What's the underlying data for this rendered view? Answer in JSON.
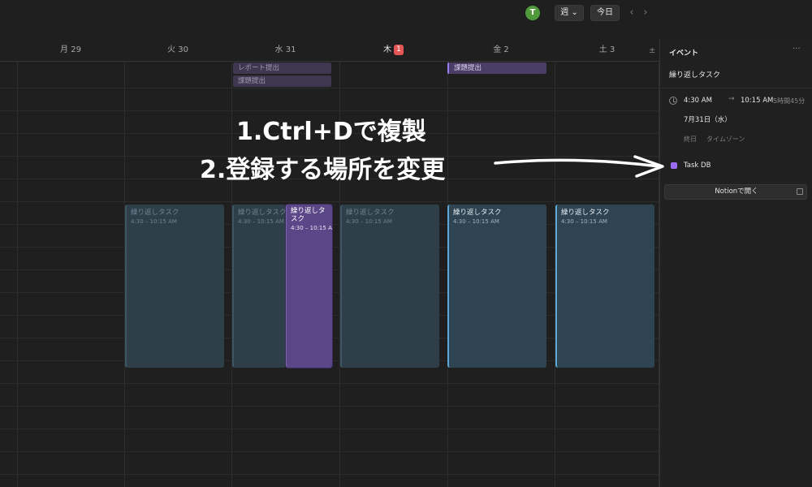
{
  "topbar": {
    "avatar_initial": "T",
    "view_button_label": "週 ⌄",
    "today_button_label": "今日",
    "prev_icon": "chevron-left-icon",
    "next_icon": "chevron-right-icon",
    "avatar_color": "#4f9a3a"
  },
  "days": [
    {
      "label": "月 29"
    },
    {
      "label": "火 30"
    },
    {
      "label": "水 31"
    },
    {
      "label": "木",
      "badge": "1"
    },
    {
      "label": "金 2"
    },
    {
      "label": "土 3"
    }
  ],
  "allday_events": [
    {
      "title": "レポート提出",
      "day": "水 31"
    },
    {
      "title": "課題提出",
      "day": "水 31"
    },
    {
      "title": "課題提出",
      "day": "金 2"
    }
  ],
  "timed_events": [
    {
      "title": "繰り返しタスク",
      "time": "4:30 – 10:15 AM",
      "day": "火 30",
      "state": "dim"
    },
    {
      "title": "繰り返しタスク",
      "time": "4:30 – 10:15 AM",
      "day": "水 31",
      "state": "dim"
    },
    {
      "title": "繰り返しタスク",
      "time": "4:30 – 10:15 AM",
      "day": "水 31",
      "state": "selected"
    },
    {
      "title": "繰り返しタスク",
      "time": "4:30 – 10:15 AM",
      "day": "木",
      "state": "dim"
    },
    {
      "title": "繰り返しタスク",
      "time": "4:30 – 10:15 AM",
      "day": "金 2",
      "state": "bright"
    },
    {
      "title": "繰り返しタスク",
      "time": "4:30 – 10:15 AM",
      "day": "土 3",
      "state": "bright"
    }
  ],
  "panel": {
    "title": "イベント",
    "more_icon": "more-icon",
    "event_name": "繰り返しタスク",
    "start_time": "4:30 AM",
    "end_time": "10:15 AM",
    "duration": "5時間45分",
    "date": "7月31日（水）",
    "allday_label": "終日",
    "timezone_label": "タイムゾーン",
    "database": "Task DB",
    "database_color": "#9b6cf0",
    "open_button_label": "Notionで開く"
  },
  "annotation": {
    "line1": "1.Ctrl+Dで複製",
    "line2": "2.登録する場所を変更"
  },
  "colors": {
    "background": "#1f1f1f",
    "selected_event": "#5b4687",
    "event_bg": "#2e4452",
    "accent_blue": "#5aa8d8",
    "badge_red": "#e45555"
  }
}
